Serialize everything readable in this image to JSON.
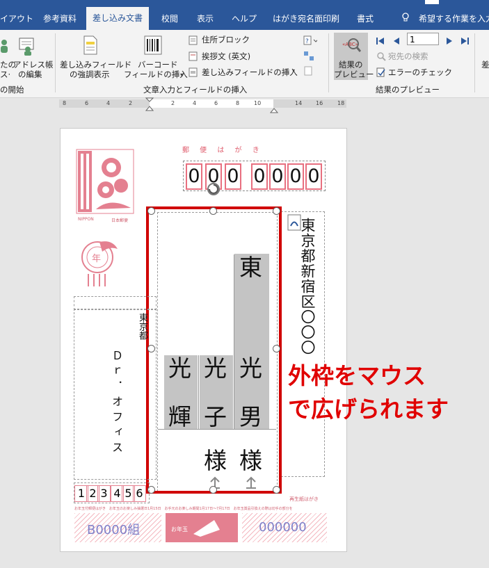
{
  "tabs": [
    "イアウト",
    "参考資料",
    "差し込み文書",
    "校閲",
    "表示",
    "ヘルプ",
    "はがき宛名面印刷",
    "書式"
  ],
  "tell_me": "希望する作業を入力",
  "ribbon": {
    "partial_btn1": "たの",
    "partial_btn1b": "ス·",
    "address_book_line1": "アドレス帳",
    "address_book_line2": "の編集",
    "highlight_line1": "差し込みフィールド",
    "highlight_line2": "の強調表示",
    "barcode_line1": "バーコード",
    "barcode_line2": "フィールドの挿入",
    "address_block": "住所ブロック",
    "greeting": "挨拶文 (英文)",
    "insert_field": "差し込みフィールドの挿入",
    "preview_line1": "結果の",
    "preview_line2": "プレビュー",
    "record_value": "1",
    "find_recipient": "宛先の検索",
    "check_errors": "エラーのチェック",
    "group_start": "の開始",
    "group_fields": "文章入力とフィールドの挿入",
    "group_preview": "結果のプレビュー",
    "cut_right": "差"
  },
  "ruler": [
    "8",
    "6",
    "4",
    "2",
    "2",
    "4",
    "6",
    "8",
    "10",
    "14",
    "16",
    "18"
  ],
  "postcard": {
    "header": "郵 便 は が き",
    "zip": [
      "0",
      "0",
      "0",
      "0",
      "0",
      "0",
      "0"
    ],
    "stamp_label": "NIPPON",
    "stamp_label2": "日本郵便",
    "recipient_address": "東京都新宿区〇〇〇",
    "family_name": "東",
    "given_names": [
      "光",
      "輝",
      "光",
      "子",
      "光",
      "男"
    ],
    "honorifics": [
      "様",
      "様"
    ],
    "sender_address": "東京都",
    "sender_name": "Ｄｒ．オフィス",
    "sender_zip": [
      "1",
      "2",
      "3",
      "4",
      "5",
      "6"
    ],
    "lottery_note": "お年玉付郵便はがき　お年玉のお楽しみ抽選日1月15日　お手元のお楽しみ期間1月17日〜7月17日　お年玉賞品引換えの際は切手の部分を",
    "group_label": "B0000組",
    "number_label": "000000",
    "recycle_label": "再生紙はがき"
  },
  "annotation": {
    "line1": "外枠をマウス",
    "line2": "で広げられます",
    "color": "#e00000"
  }
}
